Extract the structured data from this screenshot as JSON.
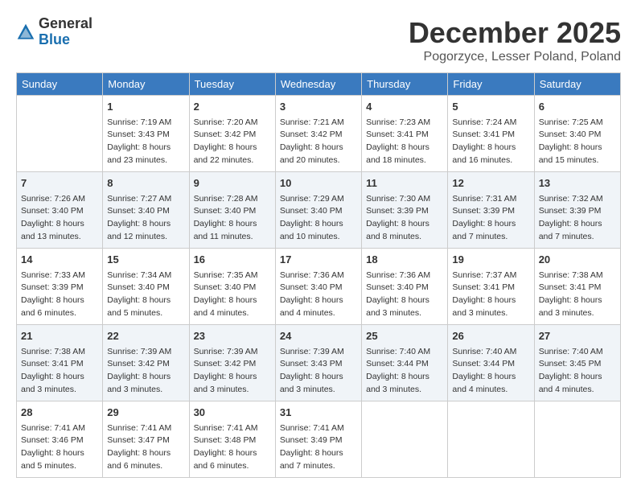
{
  "header": {
    "logo_general": "General",
    "logo_blue": "Blue",
    "month": "December 2025",
    "location": "Pogorzyce, Lesser Poland, Poland"
  },
  "weekdays": [
    "Sunday",
    "Monday",
    "Tuesday",
    "Wednesday",
    "Thursday",
    "Friday",
    "Saturday"
  ],
  "weeks": [
    [
      {
        "day": "",
        "info": ""
      },
      {
        "day": "1",
        "info": "Sunrise: 7:19 AM\nSunset: 3:43 PM\nDaylight: 8 hours\nand 23 minutes."
      },
      {
        "day": "2",
        "info": "Sunrise: 7:20 AM\nSunset: 3:42 PM\nDaylight: 8 hours\nand 22 minutes."
      },
      {
        "day": "3",
        "info": "Sunrise: 7:21 AM\nSunset: 3:42 PM\nDaylight: 8 hours\nand 20 minutes."
      },
      {
        "day": "4",
        "info": "Sunrise: 7:23 AM\nSunset: 3:41 PM\nDaylight: 8 hours\nand 18 minutes."
      },
      {
        "day": "5",
        "info": "Sunrise: 7:24 AM\nSunset: 3:41 PM\nDaylight: 8 hours\nand 16 minutes."
      },
      {
        "day": "6",
        "info": "Sunrise: 7:25 AM\nSunset: 3:40 PM\nDaylight: 8 hours\nand 15 minutes."
      }
    ],
    [
      {
        "day": "7",
        "info": "Sunrise: 7:26 AM\nSunset: 3:40 PM\nDaylight: 8 hours\nand 13 minutes."
      },
      {
        "day": "8",
        "info": "Sunrise: 7:27 AM\nSunset: 3:40 PM\nDaylight: 8 hours\nand 12 minutes."
      },
      {
        "day": "9",
        "info": "Sunrise: 7:28 AM\nSunset: 3:40 PM\nDaylight: 8 hours\nand 11 minutes."
      },
      {
        "day": "10",
        "info": "Sunrise: 7:29 AM\nSunset: 3:40 PM\nDaylight: 8 hours\nand 10 minutes."
      },
      {
        "day": "11",
        "info": "Sunrise: 7:30 AM\nSunset: 3:39 PM\nDaylight: 8 hours\nand 8 minutes."
      },
      {
        "day": "12",
        "info": "Sunrise: 7:31 AM\nSunset: 3:39 PM\nDaylight: 8 hours\nand 7 minutes."
      },
      {
        "day": "13",
        "info": "Sunrise: 7:32 AM\nSunset: 3:39 PM\nDaylight: 8 hours\nand 7 minutes."
      }
    ],
    [
      {
        "day": "14",
        "info": "Sunrise: 7:33 AM\nSunset: 3:39 PM\nDaylight: 8 hours\nand 6 minutes."
      },
      {
        "day": "15",
        "info": "Sunrise: 7:34 AM\nSunset: 3:40 PM\nDaylight: 8 hours\nand 5 minutes."
      },
      {
        "day": "16",
        "info": "Sunrise: 7:35 AM\nSunset: 3:40 PM\nDaylight: 8 hours\nand 4 minutes."
      },
      {
        "day": "17",
        "info": "Sunrise: 7:36 AM\nSunset: 3:40 PM\nDaylight: 8 hours\nand 4 minutes."
      },
      {
        "day": "18",
        "info": "Sunrise: 7:36 AM\nSunset: 3:40 PM\nDaylight: 8 hours\nand 3 minutes."
      },
      {
        "day": "19",
        "info": "Sunrise: 7:37 AM\nSunset: 3:41 PM\nDaylight: 8 hours\nand 3 minutes."
      },
      {
        "day": "20",
        "info": "Sunrise: 7:38 AM\nSunset: 3:41 PM\nDaylight: 8 hours\nand 3 minutes."
      }
    ],
    [
      {
        "day": "21",
        "info": "Sunrise: 7:38 AM\nSunset: 3:41 PM\nDaylight: 8 hours\nand 3 minutes."
      },
      {
        "day": "22",
        "info": "Sunrise: 7:39 AM\nSunset: 3:42 PM\nDaylight: 8 hours\nand 3 minutes."
      },
      {
        "day": "23",
        "info": "Sunrise: 7:39 AM\nSunset: 3:42 PM\nDaylight: 8 hours\nand 3 minutes."
      },
      {
        "day": "24",
        "info": "Sunrise: 7:39 AM\nSunset: 3:43 PM\nDaylight: 8 hours\nand 3 minutes."
      },
      {
        "day": "25",
        "info": "Sunrise: 7:40 AM\nSunset: 3:44 PM\nDaylight: 8 hours\nand 3 minutes."
      },
      {
        "day": "26",
        "info": "Sunrise: 7:40 AM\nSunset: 3:44 PM\nDaylight: 8 hours\nand 4 minutes."
      },
      {
        "day": "27",
        "info": "Sunrise: 7:40 AM\nSunset: 3:45 PM\nDaylight: 8 hours\nand 4 minutes."
      }
    ],
    [
      {
        "day": "28",
        "info": "Sunrise: 7:41 AM\nSunset: 3:46 PM\nDaylight: 8 hours\nand 5 minutes."
      },
      {
        "day": "29",
        "info": "Sunrise: 7:41 AM\nSunset: 3:47 PM\nDaylight: 8 hours\nand 6 minutes."
      },
      {
        "day": "30",
        "info": "Sunrise: 7:41 AM\nSunset: 3:48 PM\nDaylight: 8 hours\nand 6 minutes."
      },
      {
        "day": "31",
        "info": "Sunrise: 7:41 AM\nSunset: 3:49 PM\nDaylight: 8 hours\nand 7 minutes."
      },
      {
        "day": "",
        "info": ""
      },
      {
        "day": "",
        "info": ""
      },
      {
        "day": "",
        "info": ""
      }
    ]
  ]
}
